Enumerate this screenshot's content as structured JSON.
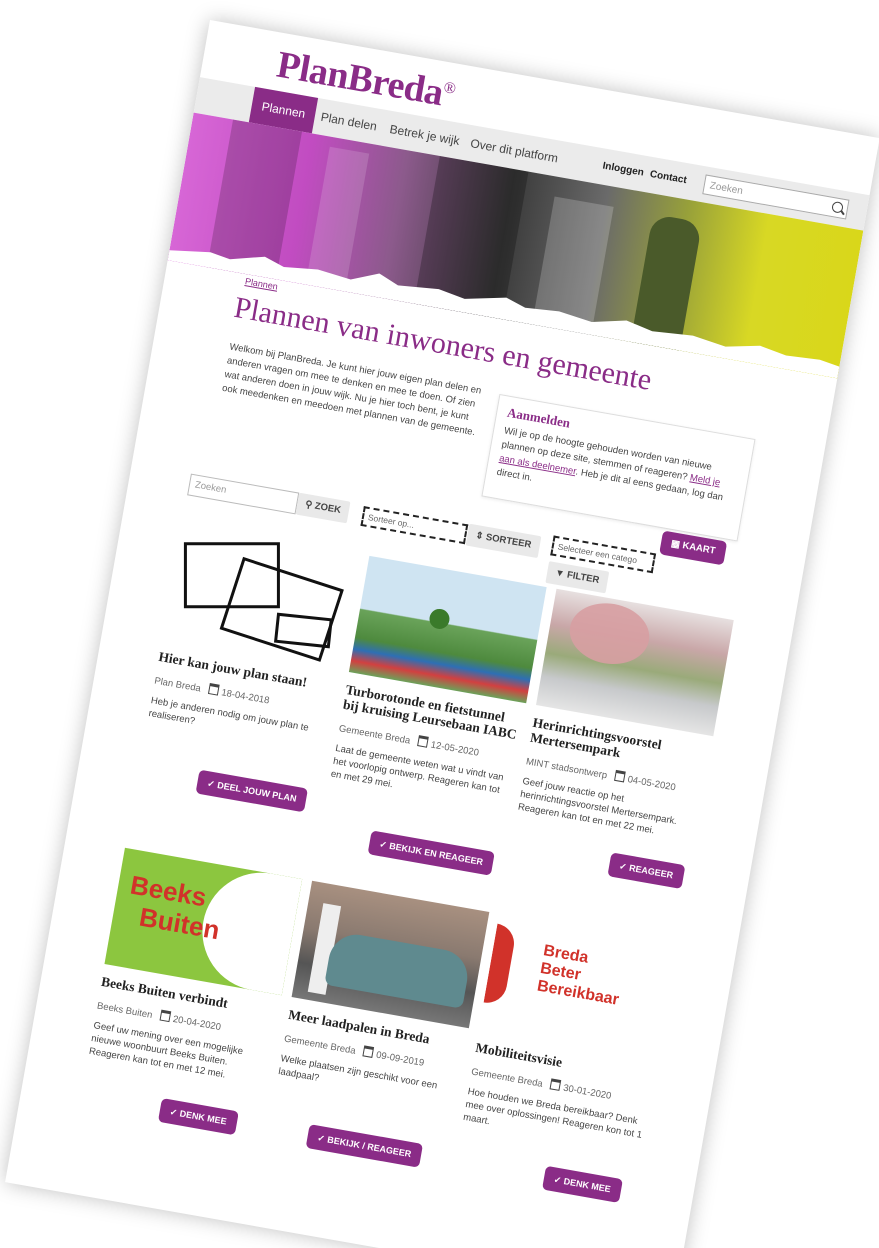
{
  "header": {
    "logo": "PlanBreda",
    "logo_mark": "®",
    "nav": [
      "Plannen",
      "Plan delen",
      "Betrek je wijk",
      "Over dit platform"
    ],
    "login": "Inloggen",
    "contact": "Contact",
    "search_placeholder": "Zoeken"
  },
  "breadcrumb": "Plannen",
  "page_title": "Plannen van inwoners en gemeente",
  "intro": "Welkom bij PlanBreda. Je kunt hier jouw eigen plan delen en anderen vragen om mee te denken en mee te doen. Of zien wat anderen doen in jouw wijk. Nu je hier toch bent, je kunt ook meedenken en meedoen met plannen van de gemeente.",
  "login_box": {
    "title": "Aanmelden",
    "text_1": "Wil je op de hoogte gehouden worden van nieuwe plannen op deze site, stemmen of reageren?",
    "link": "Meld je aan als deelnemer",
    "text_2": ". Heb je dit al eens gedaan, log dan direct in."
  },
  "filters": {
    "search_placeholder": "Zoeken",
    "search_button": "ZOEK",
    "sort_select": "Sorteer op...",
    "sort_button": "SORTEER",
    "map_button": "KAART",
    "category_select": "Selecteer een catego",
    "filter_button": "FILTER"
  },
  "cards": [
    {
      "title": "Hier kan jouw plan staan!",
      "author": "Plan Breda",
      "date": "18-04-2018",
      "desc": "Heb je anderen nodig om jouw plan te realiseren?",
      "button": "DEEL JOUW PLAN"
    },
    {
      "title": "Turborotonde en fietstunnel bij kruising Leursebaan IABC",
      "author": "Gemeente Breda",
      "date": "12-05-2020",
      "desc": "Laat de gemeente weten wat u vindt van het voorlopig ontwerp. Reageren kan tot en met 29 mei.",
      "button": "BEKIJK EN REAGEER"
    },
    {
      "title": "Herinrichtingsvoorstel Mertersempark",
      "author": "MINT stadsontwerp",
      "date": "04-05-2020",
      "desc": "Geef jouw reactie op het herinrichtingsvoorstel Mertersempark. Reageren kan tot en met 22 mei.",
      "button": "REAGEER"
    },
    {
      "title": "Beeks Buiten verbindt",
      "author": "Beeks Buiten",
      "date": "20-04-2020",
      "desc": "Geef uw mening over een mogelijke nieuwe woonbuurt Beeks Buiten. Reageren kan tot en met 12 mei.",
      "button": "DENK MEE",
      "image_text": "Beeks Buiten"
    },
    {
      "title": "Meer laadpalen in Breda",
      "author": "Gemeente Breda",
      "date": "09-09-2019",
      "desc": "Welke plaatsen zijn geschikt voor een laadpaal?",
      "button": "BEKIJK / REAGEER"
    },
    {
      "title": "Mobiliteitsvisie",
      "author": "Gemeente Breda",
      "date": "30-01-2020",
      "desc": "Hoe houden we Breda bereikbaar? Denk mee over oplossingen! Reageren kon tot 1 maart.",
      "button": "DENK MEE",
      "image_text": "Breda Beter Bereikbaar"
    }
  ],
  "colors": {
    "brand": "#8a2c87",
    "navbar": "#ebebeb"
  }
}
